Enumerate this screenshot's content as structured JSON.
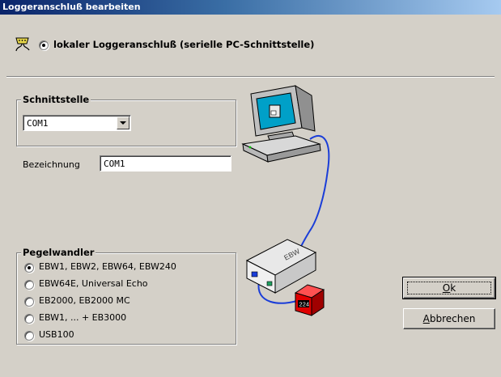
{
  "window": {
    "title": "Loggeranschluß bearbeiten"
  },
  "connection": {
    "label": "lokaler Loggeranschluß (serielle PC-Schnittstelle)",
    "selected": true
  },
  "schnittstelle": {
    "title": "Schnittstelle",
    "port_value": "COM1",
    "bezeichnung_label": "Bezeichnung",
    "bezeichnung_value": "COM1"
  },
  "pegelwandler": {
    "title": "Pegelwandler",
    "options": [
      {
        "label": "EBW1, EBW2, EBW64, EBW240",
        "selected": true
      },
      {
        "label": "EBW64E, Universal Echo",
        "selected": false
      },
      {
        "label": "EB2000, EB2000 MC",
        "selected": false
      },
      {
        "label": "EBW1, ... + EB3000",
        "selected": false
      },
      {
        "label": "USB100",
        "selected": false
      }
    ]
  },
  "illustration": {
    "device_label": "EBW",
    "display_value": "224"
  },
  "buttons": {
    "ok_first": "O",
    "ok_rest": "k",
    "cancel_first": "A",
    "cancel_rest": "bbrechen"
  },
  "colors": {
    "titlebar_start": "#0a246a",
    "titlebar_end": "#a6caf0",
    "dialog_bg": "#d4d0c8"
  }
}
